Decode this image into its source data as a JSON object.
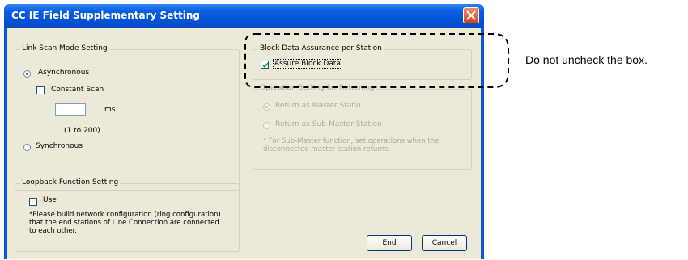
{
  "window": {
    "title": "CC IE Field Supplementary Setting"
  },
  "link_scan": {
    "legend": "Link Scan Mode Setting",
    "asynchronous": "Asynchronous",
    "constant_scan": "Constant Scan",
    "ms_unit": "ms",
    "range_hint": "(1 to 200)",
    "synchronous": "Synchronous"
  },
  "loopback": {
    "legend": "Loopback Function Setting",
    "use_label": "Use",
    "note_lines": [
      "*Please build network configuration (ring configuration)",
      "that the end stations of Line Connection are connected",
      "to each other."
    ]
  },
  "block_data": {
    "legend": "Block Data Assurance per Station",
    "assure_label": "Assure Block Data",
    "assure_checked": true
  },
  "operation_return": {
    "legend": "Operation Setting for Returning",
    "master": "Return as Master Statio",
    "submaster": "Return as Sub-Master Station",
    "note_lines": [
      "* For Sub-Master function, set operations when the",
      "disconnected master station returns."
    ]
  },
  "buttons": {
    "end": "End",
    "cancel": "Cancel"
  },
  "annotation": {
    "text": "Do not uncheck the box."
  },
  "colors": {
    "title_bar": "#0a58d8",
    "dialog_bg": "#ece9d8",
    "close_button": "#d6401c"
  }
}
